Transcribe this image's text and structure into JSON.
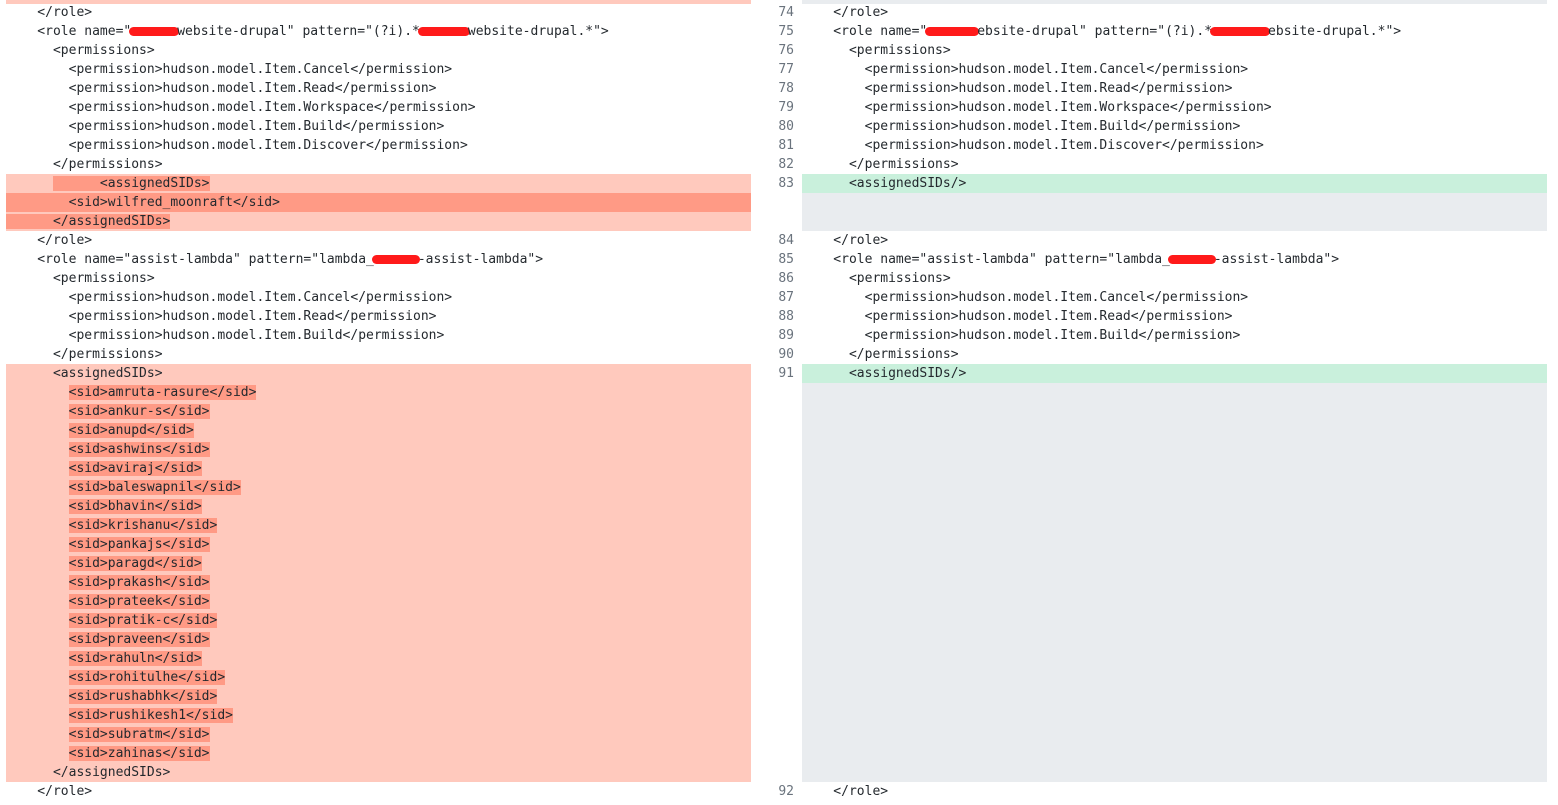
{
  "left": {
    "lines": [
      "    </role>",
      "    <role name=\"",
      "website-drupal\" pattern=\"(?i).*",
      "website-drupal.*\">",
      "      <permissions>",
      "        <permission>hudson.model.Item.Cancel</permission>",
      "        <permission>hudson.model.Item.Read</permission>",
      "        <permission>hudson.model.Item.Workspace</permission>",
      "        <permission>hudson.model.Item.Build</permission>",
      "        <permission>hudson.model.Item.Discover</permission>",
      "      </permissions>",
      "      <assignedSIDs>",
      "        <sid>wilfred_moonraft</sid>",
      "      </assignedSIDs>",
      "    </role>",
      "    <role name=\"assist-lambda\" pattern=\"lambda_",
      "-assist-lambda\">",
      "      <permissions>",
      "        <permission>hudson.model.Item.Cancel</permission>",
      "        <permission>hudson.model.Item.Read</permission>",
      "        <permission>hudson.model.Item.Build</permission>",
      "      </permissions>",
      "      <assignedSIDs>",
      "      </assignedSIDs>",
      "    </role>"
    ],
    "sids": [
      "<sid>amruta-rasure</sid>",
      "<sid>ankur-s</sid>",
      "<sid>anupd</sid>",
      "<sid>ashwins</sid>",
      "<sid>aviraj</sid>",
      "<sid>baleswapnil</sid>",
      "<sid>bhavin</sid>",
      "<sid>krishanu</sid>",
      "<sid>pankajs</sid>",
      "<sid>paragd</sid>",
      "<sid>prakash</sid>",
      "<sid>prateek</sid>",
      "<sid>pratik-c</sid>",
      "<sid>praveen</sid>",
      "<sid>rahuln</sid>",
      "<sid>rohitulhe</sid>",
      "<sid>rushabhk</sid>",
      "<sid>rushikesh1</sid>",
      "<sid>subratm</sid>",
      "<sid>zahinas</sid>"
    ]
  },
  "right": {
    "line_numbers": [
      "74",
      "75",
      "76",
      "77",
      "78",
      "79",
      "80",
      "81",
      "82",
      "83",
      "84",
      "85",
      "86",
      "87",
      "88",
      "89",
      "90",
      "91",
      "92"
    ],
    "lines": [
      "    </role>",
      "    <role name=\"",
      "ebsite-drupal\" pattern=\"(?i).*",
      "ebsite-drupal.*\">",
      "      <permissions>",
      "        <permission>hudson.model.Item.Cancel</permission>",
      "        <permission>hudson.model.Item.Read</permission>",
      "        <permission>hudson.model.Item.Workspace</permission>",
      "        <permission>hudson.model.Item.Build</permission>",
      "        <permission>hudson.model.Item.Discover</permission>",
      "      </permissions>",
      "      <assignedSIDs/>",
      "    </role>",
      "    <role name=\"assist-lambda\" pattern=\"lambda_",
      "-assist-lambda\">",
      "      <permissions>",
      "        <permission>hudson.model.Item.Cancel</permission>",
      "        <permission>hudson.model.Item.Read</permission>",
      "        <permission>hudson.model.Item.Build</permission>",
      "      </permissions>",
      "      <assignedSIDs/>",
      "    </role>"
    ]
  },
  "colors": {
    "deleted_line": "#ffc9bd",
    "deleted_word": "#ff9a85",
    "added_line": "#c9f0dc",
    "placeholder": "#e9ecef",
    "redaction": "#ff1a1a"
  }
}
